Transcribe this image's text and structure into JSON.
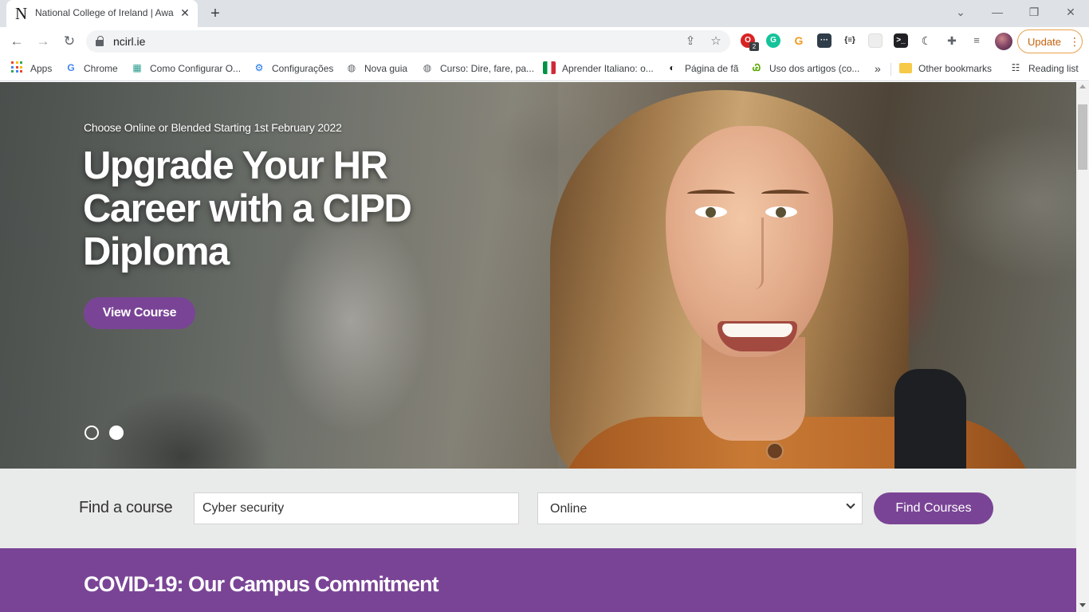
{
  "browser": {
    "tab_title": "National College of Ireland | Awa",
    "tab_favicon": "N",
    "url": "ncirl.ie",
    "update_label": "Update",
    "extension_badge": "2",
    "bookmarks": [
      {
        "label": "Apps",
        "icon": "apps-grid-icon"
      },
      {
        "label": "Chrome",
        "icon": "google-icon"
      },
      {
        "label": "Como Configurar O...",
        "icon": "cube-icon"
      },
      {
        "label": "Configurações",
        "icon": "gear-icon"
      },
      {
        "label": "Nova guia",
        "icon": "globe-icon"
      },
      {
        "label": "Curso: Dire, fare, pa...",
        "icon": "globe-icon"
      },
      {
        "label": "Aprender Italiano: o...",
        "icon": "italy-flag-icon"
      },
      {
        "label": "Página de fã",
        "icon": "yin-yang-icon"
      },
      {
        "label": "Uso dos artigos (co...",
        "icon": "duolingo-icon"
      },
      {
        "label": "»",
        "icon": "more-chevron-icon"
      },
      {
        "label": "Other bookmarks",
        "icon": "folder-icon"
      },
      {
        "label": "Reading list",
        "icon": "reading-list-icon"
      }
    ]
  },
  "hero": {
    "eyebrow": "Choose Online or Blended Starting 1st February 2022",
    "title": "Upgrade Your HR Career with a CIPD Diploma",
    "cta_label": "View Course",
    "slide_count": 2,
    "active_slide": 2
  },
  "finder": {
    "label": "Find a course",
    "search_value": "Cyber security",
    "mode_selected": "Online",
    "button_label": "Find Courses"
  },
  "covid": {
    "title": "COVID-19: Our Campus Commitment"
  },
  "colors": {
    "brand_purple": "#7a4496",
    "finder_bg": "#e9eaea",
    "chrome_tabstrip": "#dee1e6"
  }
}
